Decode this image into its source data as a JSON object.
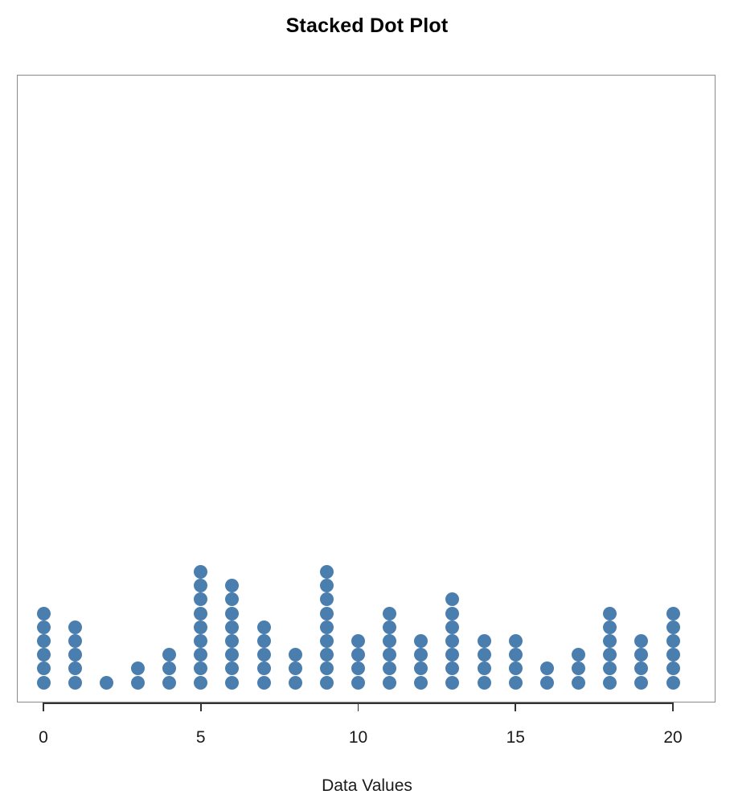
{
  "chart_data": {
    "type": "bar",
    "plot_style": "stacked-dot-plot",
    "title": "Stacked Dot Plot",
    "xlabel": "Data Values",
    "ylabel": "",
    "categories": [
      0,
      1,
      2,
      3,
      4,
      5,
      6,
      7,
      8,
      9,
      10,
      11,
      12,
      13,
      14,
      15,
      16,
      17,
      18,
      19,
      20
    ],
    "values": [
      6,
      5,
      1,
      2,
      3,
      9,
      8,
      5,
      3,
      9,
      4,
      6,
      4,
      7,
      4,
      4,
      2,
      3,
      6,
      4,
      6
    ],
    "xticks": [
      0,
      5,
      10,
      15,
      20
    ],
    "xtick_labels": [
      "0",
      "5",
      "10",
      "15",
      "20"
    ],
    "xlim": [
      -0.55,
      20.55
    ],
    "ylim": [
      0,
      22
    ],
    "grid": false,
    "legend": null,
    "dot_color": "#4A7EAE",
    "box_border_color": "#8a8a8a",
    "axis_color": "#333333",
    "background": "#ffffff",
    "total_points": 101
  },
  "figure": {
    "title": "Stacked Dot Plot",
    "axis_title": "Data Values"
  }
}
